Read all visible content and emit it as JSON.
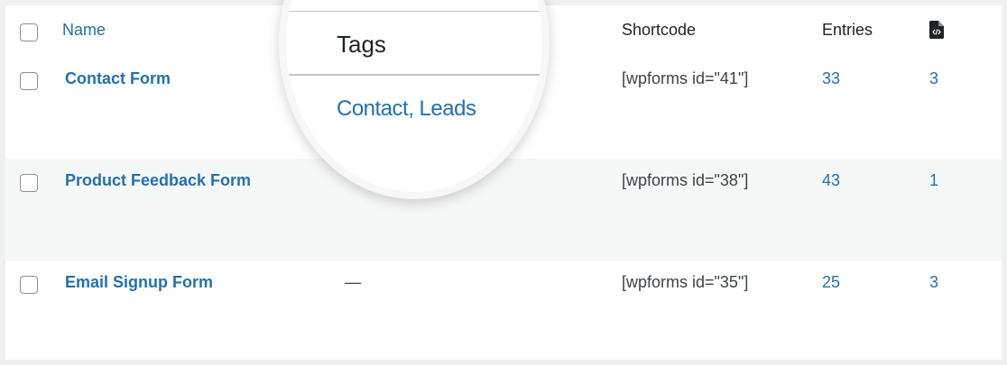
{
  "header": {
    "name": "Name",
    "shortcode": "Shortcode",
    "entries": "Entries",
    "icon": "file-code-icon"
  },
  "rows": [
    {
      "name": "Contact Form",
      "tags": "",
      "shortcode": "[wpforms id=\"41\"]",
      "entries": "33",
      "count": "3"
    },
    {
      "name": "Product Feedback Form",
      "tags": "",
      "shortcode": "[wpforms id=\"38\"]",
      "entries": "43",
      "count": "1"
    },
    {
      "name": "Email Signup Form",
      "tags": "—",
      "shortcode": "[wpforms id=\"35\"]",
      "entries": "25",
      "count": "3"
    }
  ],
  "magnifier": {
    "title": "Tags",
    "tags": "Contact, Leads"
  },
  "colors": {
    "link": "#2271b1",
    "row_alt": "#f6f7f7",
    "border": "#c3c4c7"
  }
}
